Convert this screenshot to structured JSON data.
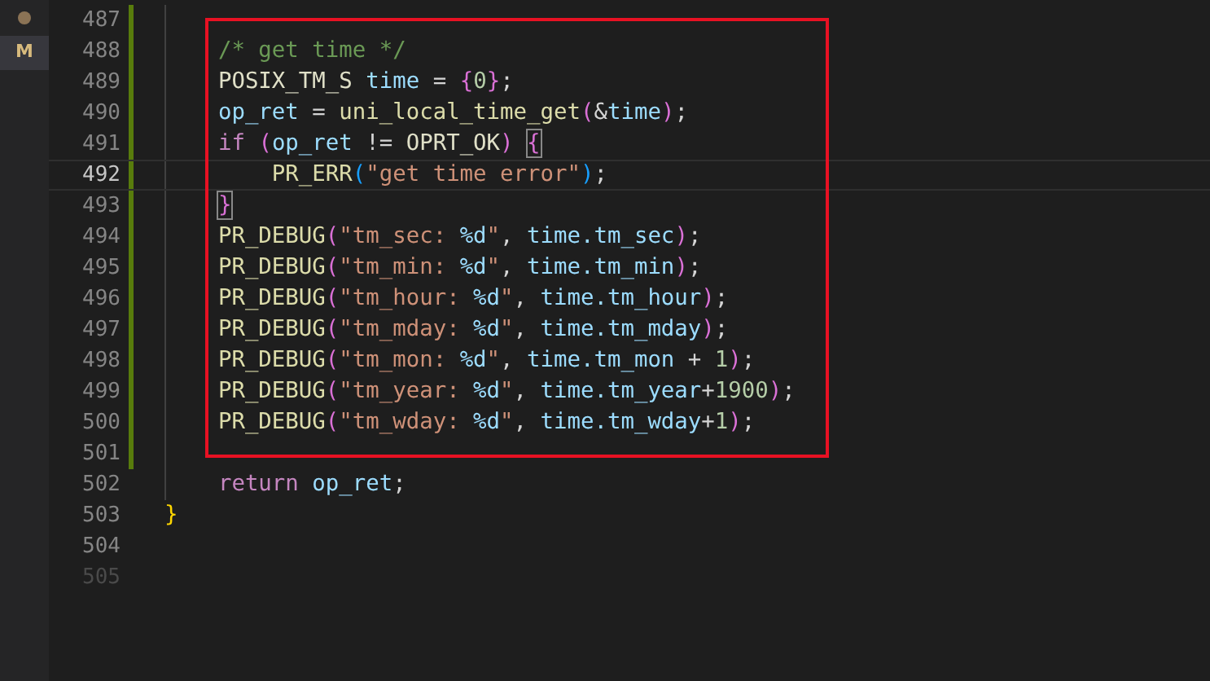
{
  "activity_strip": {
    "badge": "M"
  },
  "lines": [
    {
      "number": "487",
      "modified": true,
      "current": false,
      "boxed": false
    },
    {
      "number": "488",
      "modified": true,
      "current": false,
      "boxed": true,
      "tokens": [
        {
          "kind": "comment",
          "text": "    /* get time */"
        }
      ]
    },
    {
      "number": "489",
      "modified": true,
      "current": false,
      "boxed": true,
      "tokens": [
        {
          "kind": "type",
          "text": "    POSIX_TM_S"
        },
        {
          "kind": "variable",
          "text": " time"
        },
        {
          "kind": "plain",
          "text": " = "
        },
        {
          "kind": "bracket2",
          "text": "{"
        },
        {
          "kind": "number",
          "text": "0"
        },
        {
          "kind": "bracket2",
          "text": "}"
        },
        {
          "kind": "plain",
          "text": ";"
        }
      ]
    },
    {
      "number": "490",
      "modified": true,
      "current": false,
      "boxed": true,
      "tokens": [
        {
          "kind": "variable",
          "text": "    op_ret"
        },
        {
          "kind": "plain",
          "text": " = "
        },
        {
          "kind": "function",
          "text": "uni_local_time_get"
        },
        {
          "kind": "bracket2",
          "text": "("
        },
        {
          "kind": "plain",
          "text": "&"
        },
        {
          "kind": "variable",
          "text": "time"
        },
        {
          "kind": "bracket2",
          "text": ")"
        },
        {
          "kind": "plain",
          "text": ";"
        }
      ]
    },
    {
      "number": "491",
      "modified": true,
      "current": false,
      "boxed": true,
      "tokens": [
        {
          "kind": "keyword",
          "text": "    if"
        },
        {
          "kind": "bracket2",
          "text": " ("
        },
        {
          "kind": "variable",
          "text": "op_ret"
        },
        {
          "kind": "plain",
          "text": " != "
        },
        {
          "kind": "type",
          "text": "OPRT_OK"
        },
        {
          "kind": "bracket2",
          "text": ") "
        },
        {
          "kind": "bracket-match",
          "text": "{"
        }
      ]
    },
    {
      "number": "492",
      "modified": true,
      "current": true,
      "boxed": true,
      "tokens": [
        {
          "kind": "function",
          "text": "        PR_ERR"
        },
        {
          "kind": "bracket3",
          "text": "("
        },
        {
          "kind": "string",
          "text": "\"get time error\""
        },
        {
          "kind": "bracket3",
          "text": ")"
        },
        {
          "kind": "plain",
          "text": ";"
        }
      ]
    },
    {
      "number": "493",
      "modified": true,
      "current": false,
      "boxed": true,
      "indented": true,
      "tokens": [
        {
          "kind": "bracket-match",
          "text": "}"
        }
      ]
    },
    {
      "number": "494",
      "modified": true,
      "current": false,
      "boxed": true,
      "tokens": [
        {
          "kind": "function",
          "text": "    PR_DEBUG"
        },
        {
          "kind": "bracket2",
          "text": "("
        },
        {
          "kind": "string",
          "text": "\"tm_sec: "
        },
        {
          "kind": "format",
          "text": "%d"
        },
        {
          "kind": "string",
          "text": "\""
        },
        {
          "kind": "plain",
          "text": ", "
        },
        {
          "kind": "variable",
          "text": "time.tm_sec"
        },
        {
          "kind": "bracket2",
          "text": ")"
        },
        {
          "kind": "plain",
          "text": ";"
        }
      ]
    },
    {
      "number": "495",
      "modified": true,
      "current": false,
      "boxed": true,
      "tokens": [
        {
          "kind": "function",
          "text": "    PR_DEBUG"
        },
        {
          "kind": "bracket2",
          "text": "("
        },
        {
          "kind": "string",
          "text": "\"tm_min: "
        },
        {
          "kind": "format",
          "text": "%d"
        },
        {
          "kind": "string",
          "text": "\""
        },
        {
          "kind": "plain",
          "text": ", "
        },
        {
          "kind": "variable",
          "text": "time.tm_min"
        },
        {
          "kind": "bracket2",
          "text": ")"
        },
        {
          "kind": "plain",
          "text": ";"
        }
      ]
    },
    {
      "number": "496",
      "modified": true,
      "current": false,
      "boxed": true,
      "tokens": [
        {
          "kind": "function",
          "text": "    PR_DEBUG"
        },
        {
          "kind": "bracket2",
          "text": "("
        },
        {
          "kind": "string",
          "text": "\"tm_hour: "
        },
        {
          "kind": "format",
          "text": "%d"
        },
        {
          "kind": "string",
          "text": "\""
        },
        {
          "kind": "plain",
          "text": ", "
        },
        {
          "kind": "variable",
          "text": "time.tm_hour"
        },
        {
          "kind": "bracket2",
          "text": ")"
        },
        {
          "kind": "plain",
          "text": ";"
        }
      ]
    },
    {
      "number": "497",
      "modified": true,
      "current": false,
      "boxed": true,
      "tokens": [
        {
          "kind": "function",
          "text": "    PR_DEBUG"
        },
        {
          "kind": "bracket2",
          "text": "("
        },
        {
          "kind": "string",
          "text": "\"tm_mday: "
        },
        {
          "kind": "format",
          "text": "%d"
        },
        {
          "kind": "string",
          "text": "\""
        },
        {
          "kind": "plain",
          "text": ", "
        },
        {
          "kind": "variable",
          "text": "time.tm_mday"
        },
        {
          "kind": "bracket2",
          "text": ")"
        },
        {
          "kind": "plain",
          "text": ";"
        }
      ]
    },
    {
      "number": "498",
      "modified": true,
      "current": false,
      "boxed": true,
      "tokens": [
        {
          "kind": "function",
          "text": "    PR_DEBUG"
        },
        {
          "kind": "bracket2",
          "text": "("
        },
        {
          "kind": "string",
          "text": "\"tm_mon: "
        },
        {
          "kind": "format",
          "text": "%d"
        },
        {
          "kind": "string",
          "text": "\""
        },
        {
          "kind": "plain",
          "text": ", "
        },
        {
          "kind": "variable",
          "text": "time.tm_mon"
        },
        {
          "kind": "plain",
          "text": " + "
        },
        {
          "kind": "number",
          "text": "1"
        },
        {
          "kind": "bracket2",
          "text": ")"
        },
        {
          "kind": "plain",
          "text": ";"
        }
      ]
    },
    {
      "number": "499",
      "modified": true,
      "current": false,
      "boxed": true,
      "tokens": [
        {
          "kind": "function",
          "text": "    PR_DEBUG"
        },
        {
          "kind": "bracket2",
          "text": "("
        },
        {
          "kind": "string",
          "text": "\"tm_year: "
        },
        {
          "kind": "format",
          "text": "%d"
        },
        {
          "kind": "string",
          "text": "\""
        },
        {
          "kind": "plain",
          "text": ", "
        },
        {
          "kind": "variable",
          "text": "time.tm_year"
        },
        {
          "kind": "plain",
          "text": "+"
        },
        {
          "kind": "number",
          "text": "1900"
        },
        {
          "kind": "bracket2",
          "text": ")"
        },
        {
          "kind": "plain",
          "text": ";"
        }
      ]
    },
    {
      "number": "500",
      "modified": true,
      "current": false,
      "boxed": true,
      "tokens": [
        {
          "kind": "function",
          "text": "    PR_DEBUG"
        },
        {
          "kind": "bracket2",
          "text": "("
        },
        {
          "kind": "string",
          "text": "\"tm_wday: "
        },
        {
          "kind": "format",
          "text": "%d"
        },
        {
          "kind": "string",
          "text": "\""
        },
        {
          "kind": "plain",
          "text": ", "
        },
        {
          "kind": "variable",
          "text": "time.tm_wday"
        },
        {
          "kind": "plain",
          "text": "+"
        },
        {
          "kind": "number",
          "text": "1"
        },
        {
          "kind": "bracket2",
          "text": ")"
        },
        {
          "kind": "plain",
          "text": ";"
        }
      ]
    },
    {
      "number": "501",
      "modified": true,
      "current": false,
      "boxed": false
    },
    {
      "number": "502",
      "modified": false,
      "current": false,
      "boxed": false,
      "tokens": [
        {
          "kind": "keyword",
          "text": "    return"
        },
        {
          "kind": "variable",
          "text": " op_ret"
        },
        {
          "kind": "plain",
          "text": ";"
        }
      ]
    },
    {
      "number": "503",
      "modified": false,
      "current": false,
      "boxed": false,
      "tokens": [
        {
          "kind": "bracket1",
          "text": "}"
        }
      ]
    },
    {
      "number": "504",
      "modified": false,
      "current": false,
      "boxed": false
    },
    {
      "number": "505",
      "modified": false,
      "current": false,
      "boxed": false,
      "dim": true
    }
  ]
}
